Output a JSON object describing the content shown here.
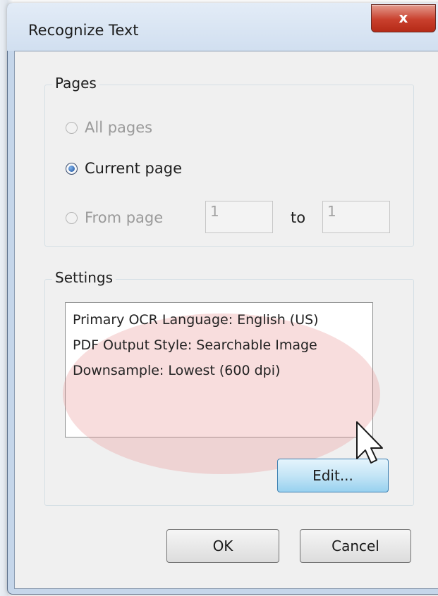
{
  "dialog": {
    "title": "Recognize Text",
    "close_symbol": "x"
  },
  "pages_group": {
    "label": "Pages",
    "all_pages_label": "All pages",
    "current_page_label": "Current page",
    "from_page_label": "From page",
    "from_value": "1",
    "to_label": "to",
    "to_value": "1",
    "selected": "current_page"
  },
  "settings_group": {
    "label": "Settings",
    "lines": [
      "Primary OCR Language: English (US)",
      "PDF Output Style: Searchable Image",
      "Downsample: Lowest (600 dpi)"
    ],
    "highlight_color": "#e89696"
  },
  "buttons": {
    "edit_label": "Edit...",
    "ok_label": "OK",
    "cancel_label": "Cancel"
  },
  "icons": {
    "close": "close-icon",
    "cursor": "mouse-pointer-icon"
  }
}
